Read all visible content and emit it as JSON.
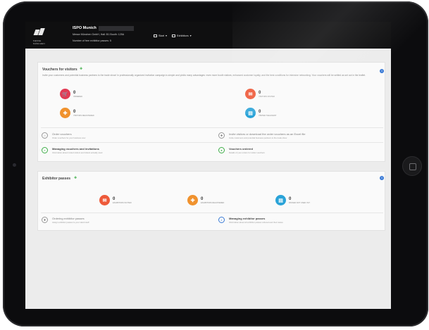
{
  "header": {
    "company": "ISPO Munich",
    "address": "Messe München GmbH, Hall: B1 Booth: 125A",
    "exhibitor_passes": "Number of free exhibitor passes: 5",
    "nav": [
      {
        "label": "Start",
        "icon": "grid-icon"
      },
      {
        "label": "Exhibitors",
        "icon": "people-icon"
      }
    ]
  },
  "vouchers": {
    "title": "Vouchers for visitors",
    "description": "Invite your customers and potential business partners to the trade show! In professionally organized invitation campaign is simple and yields many advantages: even more booth visitors, enhanced customer loyalty, and the best conditions for intensive networking. Your vouchers will be settled as set out in the leaflet.",
    "stats": [
      {
        "value": "0",
        "label": "ORDERED",
        "color": "#e23b55",
        "icon": "cart-icon"
      },
      {
        "value": "0",
        "label": "VISITORS INVITED",
        "color": "#ee5a3a",
        "icon": "envelope-icon"
      },
      {
        "value": "0",
        "label": "VISITORS REGISTERED",
        "color": "#f0922e",
        "icon": "user-add-icon"
      },
      {
        "value": "0",
        "label": "VISITED THE EVENT",
        "color": "#2aa3d8",
        "icon": "ticket-icon"
      }
    ],
    "links": [
      {
        "title": "Order vouchers",
        "sub": "Order vouchers for your business now"
      },
      {
        "title": "Invite visitors or download the order vouchers as an Excel file",
        "sub": "Invite customers and potential business partners to the trade show"
      },
      {
        "title": "Managing vouchers and invitations",
        "sub": "Information about invited visitors and tickets actually used"
      },
      {
        "title": "Vouchers ordered",
        "sub": "Details of your orders for visitor vouchers"
      }
    ]
  },
  "exhibitor": {
    "title": "Exhibitor passes",
    "stats": [
      {
        "value": "0",
        "label": "EXHIBITORS INVITED",
        "color": "#ee5a3a",
        "icon": "envelope-icon"
      },
      {
        "value": "0",
        "label": "EXHIBITORS REGISTERED",
        "color": "#f0922e",
        "icon": "user-add-icon"
      },
      {
        "value": "0",
        "label": "PASSES NOT USED YET",
        "color": "#2aa3d8",
        "icon": "ticket-icon"
      }
    ],
    "links": [
      {
        "title": "Ordering exhibitor passes",
        "sub": "Assign exhibitor passes to your stand staff"
      },
      {
        "title": "Managing exhibitor passes",
        "sub": "Information about all exhibitor passes ordered and their status"
      }
    ]
  },
  "colors": {
    "accent_green": "#3fae49",
    "accent_blue": "#3b7bd6",
    "header_bg": "#0f0f10"
  }
}
